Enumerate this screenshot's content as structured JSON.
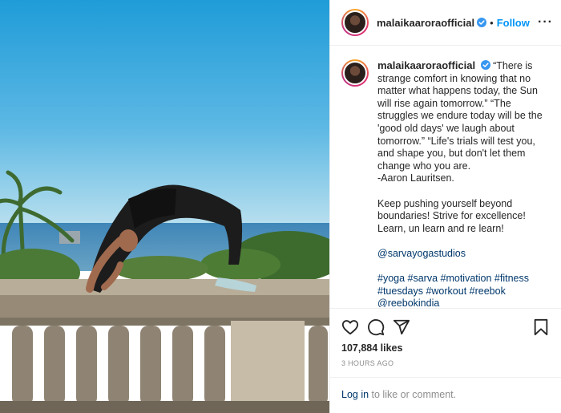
{
  "post": {
    "username": "malaikaaroraofficial",
    "follow_label": "Follow",
    "dot": "•",
    "more_label": "···",
    "photo_alt": "Woman doing a wheel pose on a stone balustrade by the sea"
  },
  "caption": {
    "username": "malaikaaroraofficial",
    "text": "“There is strange comfort in knowing that no matter what happens today, the Sun will rise again tomorrow.” “The struggles we endure today will be the 'good old days' we laugh about tomorrow.” “Life's trials will test you, and shape you, but don't let them change who you are.\n-Aaron Lauritsen.",
    "para2": "Keep pushing yourself beyond boundaries! Strive for excellence! Learn, un learn and re learn!",
    "mention": "@sarvayogastudios",
    "hashtags": "#yoga #sarva #motivation #fitness #tuesdays #workout #reebok",
    "hashtags_cut": "@reebokindia"
  },
  "actions": {
    "likes": "107,884 likes",
    "time": "3 HOURS AGO"
  },
  "login": {
    "link": "Log in",
    "rest": " to like or comment."
  },
  "colors": {
    "accent": "#0095f6",
    "link": "#00376b",
    "text": "#262626",
    "muted": "#8e8e8e"
  }
}
